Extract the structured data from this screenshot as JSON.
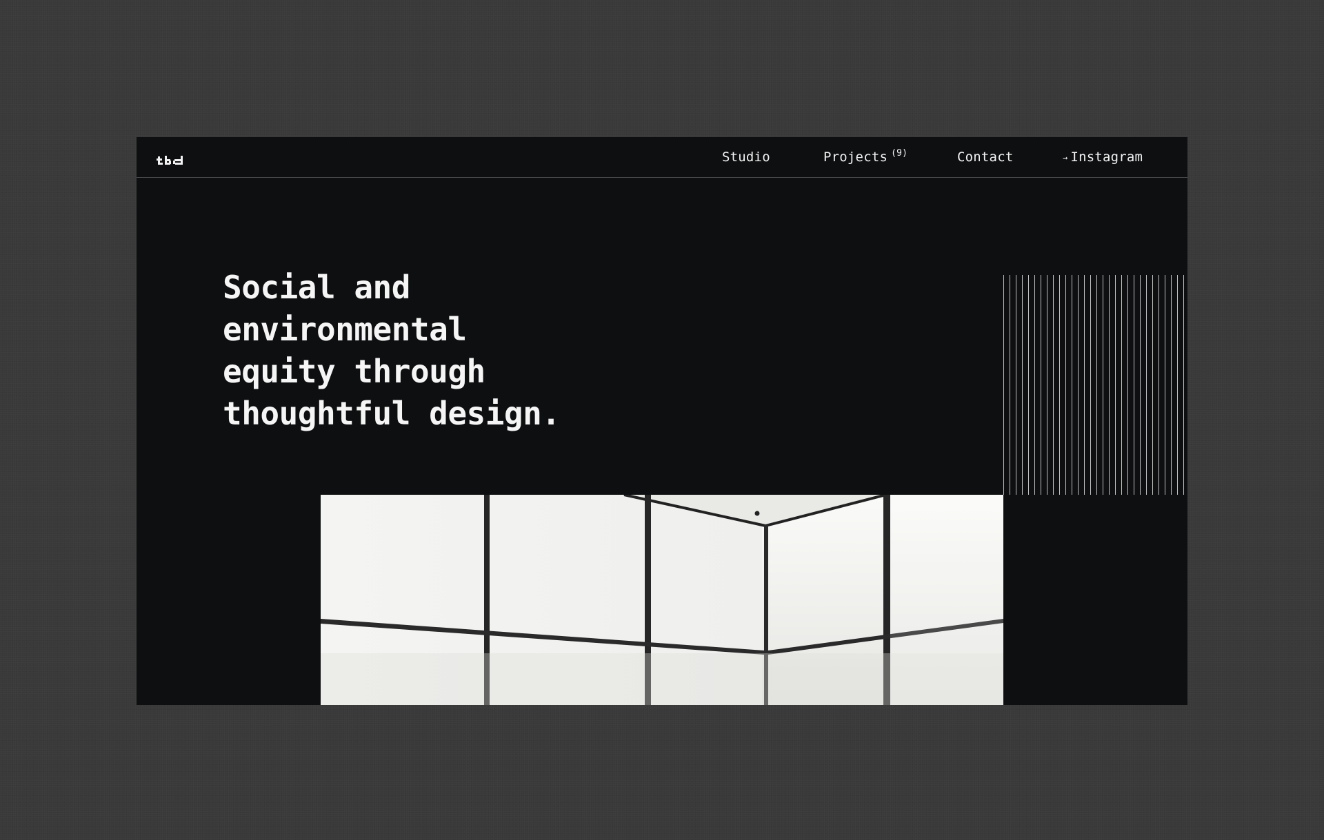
{
  "site": {
    "brand": "tbd",
    "nav": {
      "studio": "Studio",
      "projects": "Projects",
      "projects_count": "(9)",
      "contact": "Contact",
      "instagram_arrow": "→",
      "instagram": "Instagram"
    },
    "hero": {
      "line1": "Social and",
      "line2": "environmental",
      "line3": "equity through",
      "line4": "thoughtful design."
    },
    "photo_label": "window-corner-photo",
    "colors": {
      "background": "#0e0f11",
      "text": "#f5f5f5",
      "frame_backdrop": "#393939",
      "divider": "#4a4b4e"
    }
  }
}
